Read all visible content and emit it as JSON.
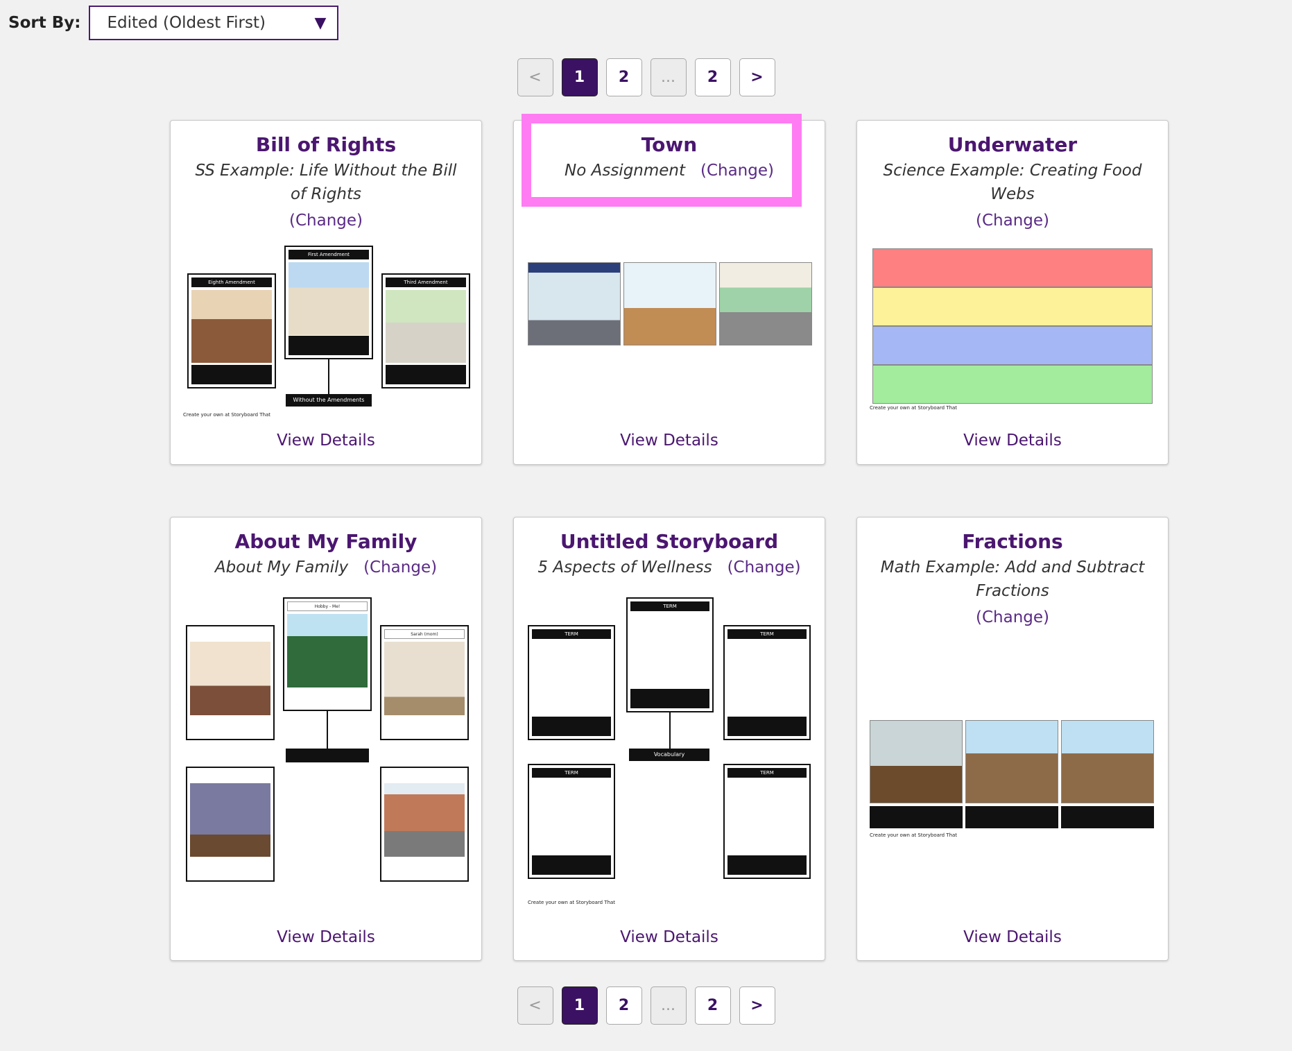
{
  "sort": {
    "label": "Sort By:",
    "value": "Edited (Oldest First)"
  },
  "pagination": {
    "prev": "<",
    "next": ">",
    "pages": [
      "1",
      "2",
      "...",
      "2"
    ],
    "active": "1"
  },
  "cards": [
    {
      "title": "Bill of Rights",
      "assignment": "SS Example: Life Without the Bill of Rights",
      "change": "(Change)",
      "view_details": "View Details",
      "thumb_labels": {
        "first": "First Amendment",
        "eighth": "Eighth Amendment",
        "third": "Third Amendment",
        "hub": "Without the Amendments",
        "credit": "Create your own at Storyboard That"
      }
    },
    {
      "title": "Town",
      "assignment": "No Assignment",
      "change": "(Change)",
      "view_details": "View Details"
    },
    {
      "title": "Underwater",
      "assignment": "Science Example: Creating Food Webs",
      "change": "(Change)",
      "view_details": "View Details",
      "thumb_labels": {
        "credit": "Create your own at Storyboard That"
      }
    },
    {
      "title": "About My Family",
      "assignment": "About My Family",
      "change": "(Change)",
      "view_details": "View Details",
      "thumb_labels": {
        "top": "Hobby - Me!",
        "right": "Sarah (mom)"
      }
    },
    {
      "title": "Untitled Storyboard",
      "assignment": "5 Aspects of Wellness",
      "change": "(Change)",
      "view_details": "View Details",
      "thumb_labels": {
        "term": "TERM",
        "hub": "Vocabulary",
        "credit": "Create your own at Storyboard That"
      }
    },
    {
      "title": "Fractions",
      "assignment": "Math Example: Add and Subtract Fractions",
      "change": "(Change)",
      "view_details": "View Details",
      "thumb_labels": {
        "credit": "Create your own at Storyboard That"
      }
    }
  ],
  "colors": {
    "brand": "#4b1670",
    "highlight": "#ff7cf2",
    "stripe_red": "#ff8080",
    "stripe_yellow": "#fdf29a",
    "stripe_blue": "#a5b8f5",
    "stripe_green": "#a3ec9e"
  }
}
